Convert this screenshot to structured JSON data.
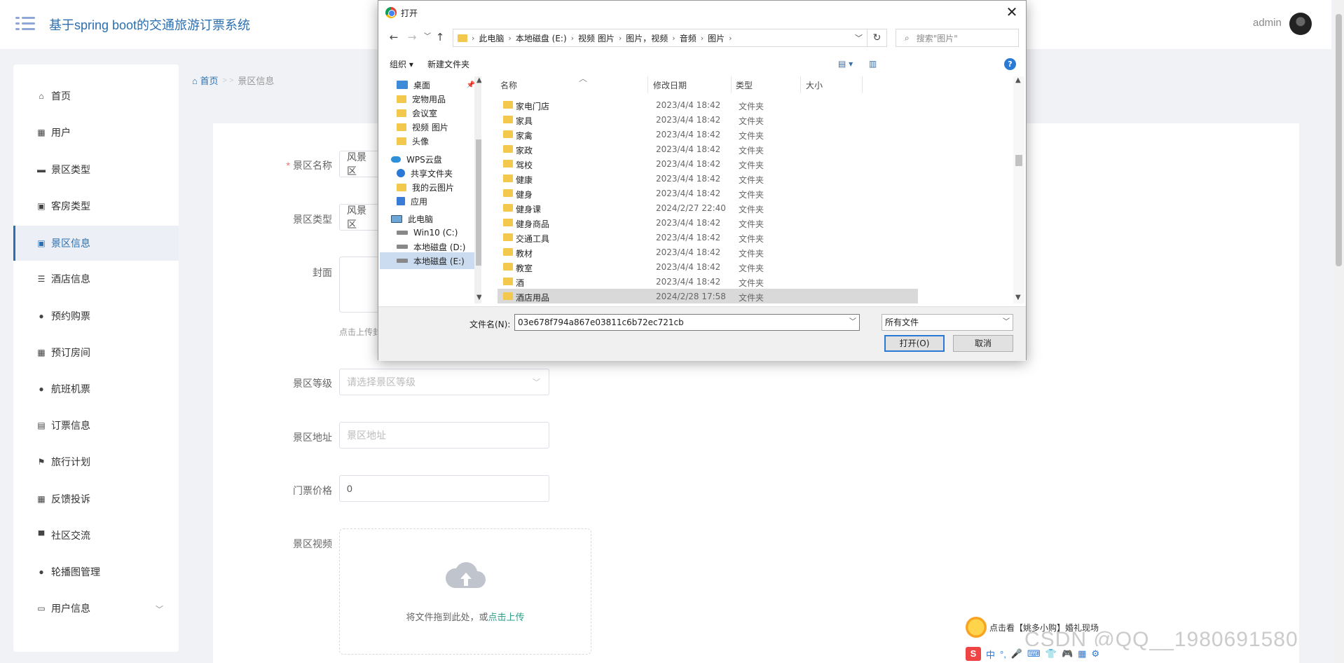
{
  "header": {
    "title": "基于spring boot的交通旅游订票系统",
    "user": "admin"
  },
  "sidebar": {
    "items": [
      {
        "label": "首页",
        "icon": "home-icon",
        "glyph": "⌂"
      },
      {
        "label": "用户",
        "icon": "grid-icon",
        "glyph": "▦"
      },
      {
        "label": "景区类型",
        "icon": "comment-icon",
        "glyph": "▬"
      },
      {
        "label": "客房类型",
        "icon": "clipboard-check-icon",
        "glyph": "▣"
      },
      {
        "label": "景区信息",
        "icon": "clipboard-x-icon",
        "glyph": "▣"
      },
      {
        "label": "酒店信息",
        "icon": "sliders-icon",
        "glyph": "☰"
      },
      {
        "label": "预约购票",
        "icon": "user-icon",
        "glyph": "●"
      },
      {
        "label": "预订房间",
        "icon": "grid-icon",
        "glyph": "▦"
      },
      {
        "label": "航班机票",
        "icon": "user-icon",
        "glyph": "●"
      },
      {
        "label": "订票信息",
        "icon": "clipboard-icon",
        "glyph": "▤"
      },
      {
        "label": "旅行计划",
        "icon": "flag-icon",
        "glyph": "⚑"
      },
      {
        "label": "反馈投诉",
        "icon": "grid-icon",
        "glyph": "▦"
      },
      {
        "label": "社区交流",
        "icon": "podium-icon",
        "glyph": "▀"
      },
      {
        "label": "轮播图管理",
        "icon": "bulb-icon",
        "glyph": "●"
      },
      {
        "label": "用户信息",
        "icon": "id-card-icon",
        "glyph": "▭"
      }
    ],
    "active": "景区信息"
  },
  "breadcrumb": {
    "home": "首页",
    "sep": "> >",
    "current": "景区信息"
  },
  "form": {
    "name_label": "景区名称",
    "name_value": "风景区",
    "type_label": "景区类型",
    "type_value": "风景区",
    "cover_label": "封面",
    "cover_tip": "点击上传封",
    "level_label": "景区等级",
    "level_placeholder": "请选择景区等级",
    "address_label": "景区地址",
    "address_placeholder": "景区地址",
    "price_label": "门票价格",
    "price_value": "0",
    "video_label": "景区视频",
    "upload_text": "将文件拖到此处，或",
    "upload_link": "点击上传"
  },
  "dialog": {
    "title": "打开",
    "path": [
      "此电脑",
      "本地磁盘 (E:)",
      "视频 图片",
      "图片，视频",
      "音频",
      "图片"
    ],
    "search_placeholder": "搜索\"图片\"",
    "organize": "组织 ▾",
    "new_folder": "新建文件夹",
    "columns": [
      "名称",
      "修改日期",
      "类型",
      "大小"
    ],
    "nav": [
      {
        "label": "桌面",
        "kind": "desk",
        "pin": true
      },
      {
        "label": "宠物用品",
        "kind": "folder"
      },
      {
        "label": "会议室",
        "kind": "folder"
      },
      {
        "label": "视频 图片",
        "kind": "folder"
      },
      {
        "label": "头像",
        "kind": "folder"
      },
      {
        "label": "WPS云盘",
        "kind": "cloud"
      },
      {
        "label": "共享文件夹",
        "kind": "share"
      },
      {
        "label": "我的云图片",
        "kind": "folder"
      },
      {
        "label": "应用",
        "kind": "apps"
      },
      {
        "label": "此电脑",
        "kind": "pc"
      },
      {
        "label": "Win10 (C:)",
        "kind": "drive"
      },
      {
        "label": "本地磁盘 (D:)",
        "kind": "drive"
      },
      {
        "label": "本地磁盘 (E:)",
        "kind": "drive"
      }
    ],
    "files": [
      {
        "name": "家电门店",
        "date": "2023/4/4 18:42",
        "type": "文件夹"
      },
      {
        "name": "家具",
        "date": "2023/4/4 18:42",
        "type": "文件夹"
      },
      {
        "name": "家禽",
        "date": "2023/4/4 18:42",
        "type": "文件夹"
      },
      {
        "name": "家政",
        "date": "2023/4/4 18:42",
        "type": "文件夹"
      },
      {
        "name": "驾校",
        "date": "2023/4/4 18:42",
        "type": "文件夹"
      },
      {
        "name": "健康",
        "date": "2023/4/4 18:42",
        "type": "文件夹"
      },
      {
        "name": "健身",
        "date": "2023/4/4 18:42",
        "type": "文件夹"
      },
      {
        "name": "健身课",
        "date": "2024/2/27 22:40",
        "type": "文件夹"
      },
      {
        "name": "健身商品",
        "date": "2023/4/4 18:42",
        "type": "文件夹"
      },
      {
        "name": "交通工具",
        "date": "2023/4/4 18:42",
        "type": "文件夹"
      },
      {
        "name": "教材",
        "date": "2023/4/4 18:42",
        "type": "文件夹"
      },
      {
        "name": "教室",
        "date": "2023/4/4 18:42",
        "type": "文件夹"
      },
      {
        "name": "酒",
        "date": "2023/4/4 18:42",
        "type": "文件夹"
      },
      {
        "name": "酒店用品",
        "date": "2024/2/28 17:58",
        "type": "文件夹"
      }
    ],
    "filename_label": "文件名(N):",
    "filename_value": "03e678f794a867e03811c6b72ec721cb",
    "filetype": "所有文件",
    "open_button": "打开(O)",
    "cancel_button": "取消"
  },
  "overlay": {
    "promo": "点击看【姚多小购】婚礼现场",
    "watermark": "CSDN @QQ__1980691580",
    "ime_chars": "中"
  }
}
